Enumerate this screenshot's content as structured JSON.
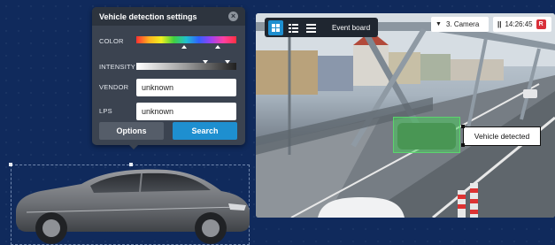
{
  "panel": {
    "title": "Vehicle detection settings",
    "close_icon": "close-icon",
    "color_label": "COLOR",
    "intensity_label": "INTENSITY",
    "vendor_label": "VENDOR",
    "vendor_value": "unknown",
    "lps_label": "LPS",
    "lps_value": "unknown",
    "options_label": "Options",
    "search_label": "Search"
  },
  "camera": {
    "event_board_label": "Event board",
    "camera_name": "3. Camera",
    "time": "14:26:45",
    "rec_badge": "R",
    "detection_label": "Vehicle detected"
  },
  "colors": {
    "background": "#102a5c",
    "panel": "#3b4350",
    "accent": "#1e8fd0",
    "detection": "#46d25a",
    "rec": "#d9303a"
  }
}
